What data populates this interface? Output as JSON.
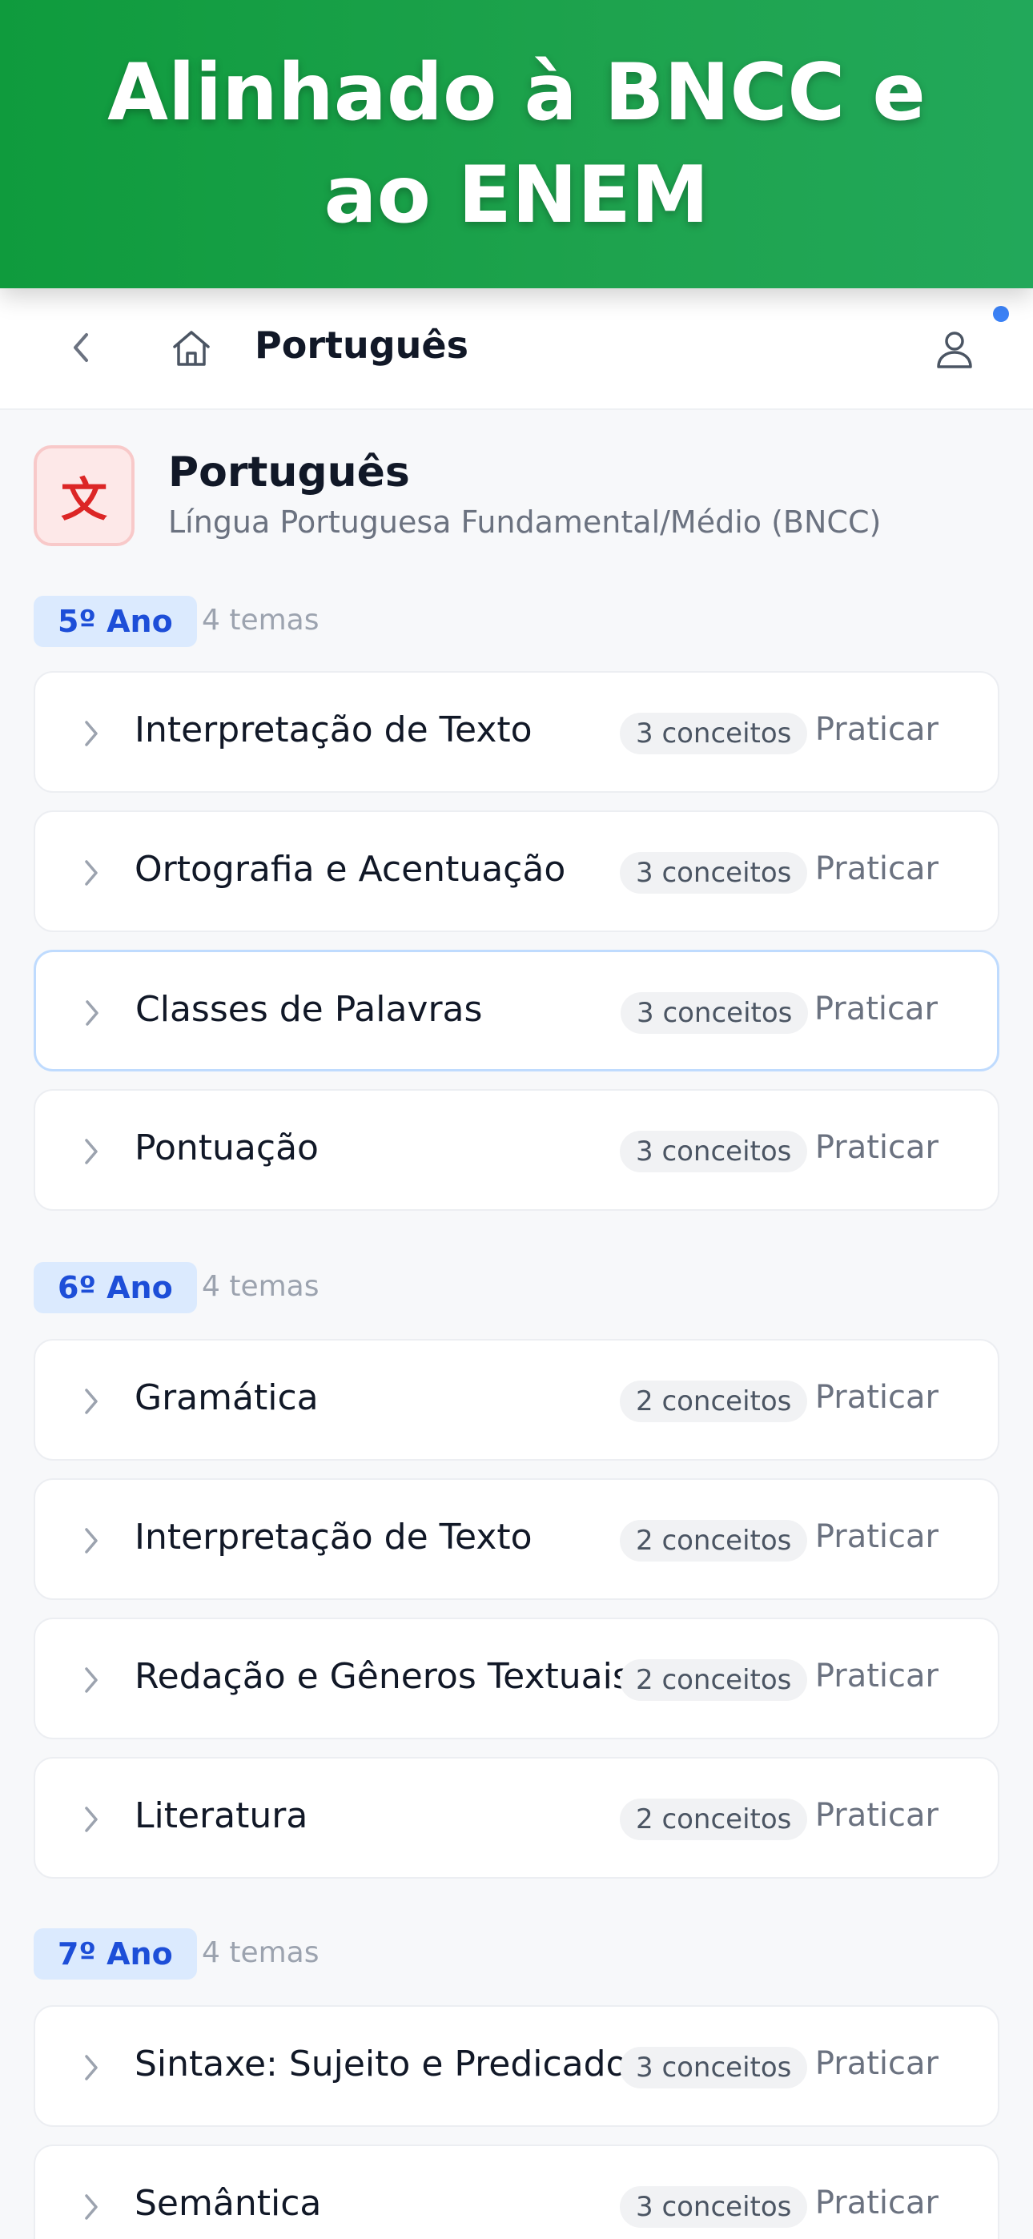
{
  "banner": {
    "headline": "Alinhado à BNCC e ao ENEM",
    "gradient_start": "#0f9b3d",
    "gradient_end": "#22a85a"
  },
  "navbar": {
    "back_icon": "chevron-left-icon",
    "home_icon": "home-icon",
    "title": "Português",
    "user_icon": "user-icon",
    "notification_dot_color": "#3b82f6"
  },
  "subject": {
    "icon_glyph": "文",
    "icon_color": "#dc2626",
    "name": "Português",
    "description": "Língua Portuguesa Fundamental/Médio (BNCC)"
  },
  "grades": [
    {
      "label": "5º Ano",
      "count": "4 temas",
      "topics": [
        {
          "name": "Interpretação de Texto",
          "concepts": "3 conceitos",
          "action": "Praticar"
        },
        {
          "name": "Ortografia e Acentuação",
          "concepts": "3 conceitos",
          "action": "Praticar"
        },
        {
          "name": "Classes de Palavras",
          "concepts": "3 conceitos",
          "action": "Praticar"
        },
        {
          "name": "Pontuação",
          "concepts": "3 conceitos",
          "action": "Praticar"
        }
      ]
    },
    {
      "label": "6º Ano",
      "count": "4 temas",
      "topics": [
        {
          "name": "Gramática",
          "concepts": "2 conceitos",
          "action": "Praticar"
        },
        {
          "name": "Interpretação de Texto",
          "concepts": "2 conceitos",
          "action": "Praticar"
        },
        {
          "name": "Redação e Gêneros Textuais",
          "concepts": "2 conceitos",
          "action": "Praticar"
        },
        {
          "name": "Literatura",
          "concepts": "2 conceitos",
          "action": "Praticar"
        }
      ]
    },
    {
      "label": "7º Ano",
      "count": "4 temas",
      "topics": [
        {
          "name": "Sintaxe: Sujeito e Predicado",
          "concepts": "3 conceitos",
          "action": "Praticar"
        },
        {
          "name": "Semântica",
          "concepts": "3 conceitos",
          "action": "Praticar"
        }
      ]
    }
  ]
}
